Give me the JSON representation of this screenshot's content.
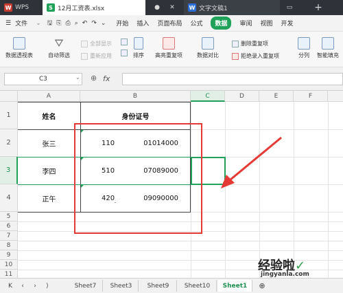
{
  "titlebar": {
    "wps_label": "WPS",
    "file_tab": "12月工资表.xlsx",
    "doc_tab": "文字文稿1",
    "new_tab_label": "+"
  },
  "menu": {
    "file_label": "文件",
    "items": [
      "开始",
      "插入",
      "页面布局",
      "公式",
      "数据",
      "审阅",
      "视图",
      "开发"
    ],
    "active_item": "数据"
  },
  "ribbon": {
    "pivot_table": "数据透视表",
    "auto_filter": "自动筛选",
    "show_all": "全部显示",
    "reapply": "重新应用",
    "sort": "排序",
    "highlight_dup": "高亮重复项",
    "data_compare": "数据对比",
    "delete_dup": "删除重复项",
    "reject_dup": "拒绝录入重复项",
    "split_column": "分列",
    "smart_fill": "智能填充"
  },
  "formula_bar": {
    "cell_ref": "C3",
    "fx_label": "fx"
  },
  "sheet": {
    "columns": [
      "A",
      "B",
      "C",
      "D",
      "E",
      "F"
    ],
    "rows": [
      "1",
      "2",
      "3",
      "4",
      "5",
      "6",
      "7",
      "8",
      "9",
      "10",
      "11"
    ],
    "headers": {
      "name": "姓名",
      "id": "身份证号"
    },
    "records": [
      {
        "name": "张三",
        "id_prefix": "110",
        "id_suffix": "01014000"
      },
      {
        "name": "李四",
        "id_prefix": "510",
        "id_suffix": "07089000"
      },
      {
        "name": "正午",
        "id_prefix": "420",
        "id_suffix": "09090000"
      }
    ]
  },
  "sheet_tabs": [
    "Sheet7",
    "Sheet3",
    "Sheet9",
    "Sheet10",
    "Sheet1"
  ],
  "active_sheet_tab": "Sheet1",
  "watermark": {
    "title": "经验啦",
    "url": "jingyanla.com"
  },
  "colors": {
    "accent": "#1fa15a",
    "annotation": "#e53935"
  }
}
